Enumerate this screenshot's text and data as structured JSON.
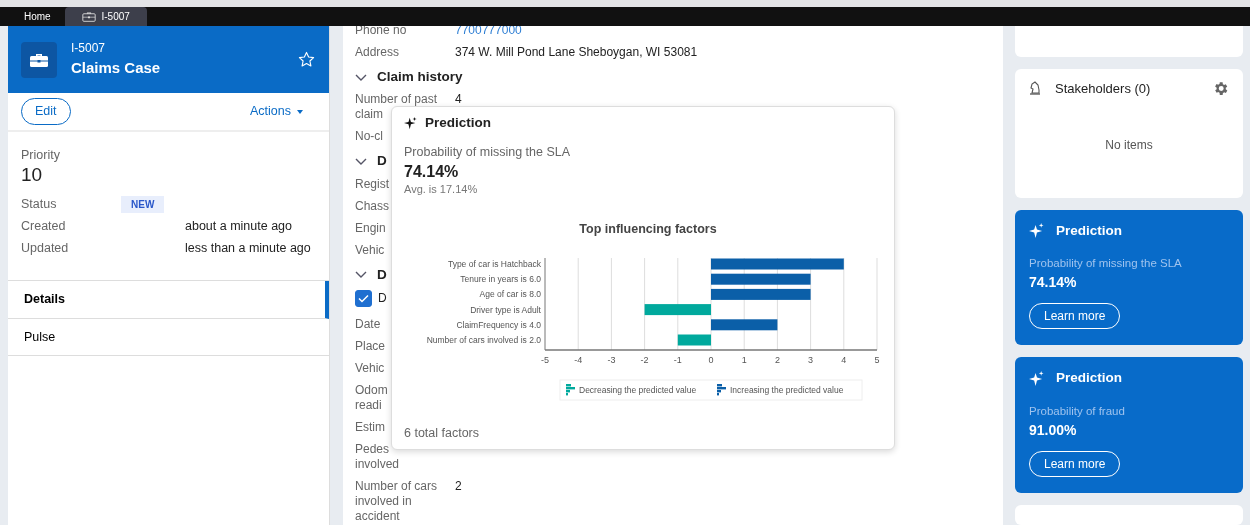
{
  "top_tabs": [
    {
      "label": "Home",
      "selected": false
    },
    {
      "label": "I-5007",
      "selected": true
    }
  ],
  "case": {
    "id": "I-5007",
    "title": "Claims Case",
    "starred": false,
    "edit": "Edit",
    "actions": "Actions"
  },
  "summary": {
    "priority_label": "Priority",
    "priority": "10",
    "fields": [
      {
        "label": "Status",
        "value": "NEW",
        "kind": "badge"
      },
      {
        "label": "Created",
        "value": "about a minute ago",
        "kind": "text"
      },
      {
        "label": "Updated",
        "value": "less than a minute ago",
        "kind": "text"
      }
    ]
  },
  "nav": [
    {
      "label": "Details",
      "selected": true
    },
    {
      "label": "Pulse",
      "selected": false
    }
  ],
  "details": [
    {
      "kind": "field",
      "lines": [
        "Phone no"
      ],
      "value": "7700777000",
      "link": true
    },
    {
      "kind": "field",
      "lines": [
        "Address"
      ],
      "value": "374 W. Mill Pond Lane Sheboygan, WI 53081"
    },
    {
      "kind": "heading",
      "label": "Claim history"
    },
    {
      "kind": "field",
      "lines": [
        "Number of past",
        "claim"
      ],
      "value": "4"
    },
    {
      "kind": "field",
      "lines": [
        "No-cl"
      ]
    },
    {
      "kind": "heading",
      "label": "D"
    },
    {
      "kind": "field",
      "lines": [
        "Regist"
      ]
    },
    {
      "kind": "field",
      "lines": [
        "Chass"
      ]
    },
    {
      "kind": "field",
      "lines": [
        "Engin"
      ]
    },
    {
      "kind": "field",
      "lines": [
        "Vehic"
      ]
    },
    {
      "kind": "heading",
      "label": "D"
    },
    {
      "kind": "checkbox",
      "label": "D",
      "checked": true
    },
    {
      "kind": "field",
      "lines": [
        "Date"
      ]
    },
    {
      "kind": "field",
      "lines": [
        "Place"
      ]
    },
    {
      "kind": "field",
      "lines": [
        "Vehic"
      ]
    },
    {
      "kind": "field",
      "lines": [
        "Odom",
        "readi"
      ]
    },
    {
      "kind": "field",
      "lines": [
        "Estim"
      ]
    },
    {
      "kind": "field",
      "lines": [
        "Pedes",
        "involved"
      ]
    },
    {
      "kind": "field",
      "lines": [
        "Number of cars",
        "involved in",
        "accident"
      ],
      "value": "2"
    }
  ],
  "popover": {
    "title": "Prediction",
    "metric_label": "Probability of missing the SLA",
    "metric": "74.14%",
    "average": "Avg. is 17.14%",
    "footer": "6 total factors",
    "chart_data": {
      "type": "bar",
      "orientation": "horizontal",
      "stacked": true,
      "grid": true,
      "legend": "bottom",
      "title": "Top influencing factors",
      "categories": [
        "Type of car is Hatchback",
        "Tenure in years is 6.0",
        "Age of car is 8.0",
        "Driver type is Adult",
        "ClaimFrequency is 4.0",
        "Number of cars involved is 2.0"
      ],
      "series": [
        {
          "name": "Decreasing the predicted value",
          "color": "#00a99d",
          "values": [
            null,
            null,
            null,
            -2,
            null,
            -1
          ]
        },
        {
          "name": "Increasing the predicted value",
          "color": "#0b5fa8",
          "values": [
            4,
            3,
            3,
            null,
            2,
            null
          ]
        }
      ],
      "xlim": [
        -5,
        5
      ],
      "xticks": [
        -5,
        -4,
        -3,
        -2,
        -1,
        0,
        1,
        2,
        3,
        4,
        5
      ]
    }
  },
  "stakeholders": {
    "title": "Stakeholders (0)",
    "empty": "No items"
  },
  "predictions": [
    {
      "title": "Prediction",
      "label": "Probability of missing the SLA",
      "value": "74.14%",
      "button": "Learn more"
    },
    {
      "title": "Prediction",
      "label": "Probability of fraud",
      "value": "91.00%",
      "button": "Learn more"
    }
  ]
}
